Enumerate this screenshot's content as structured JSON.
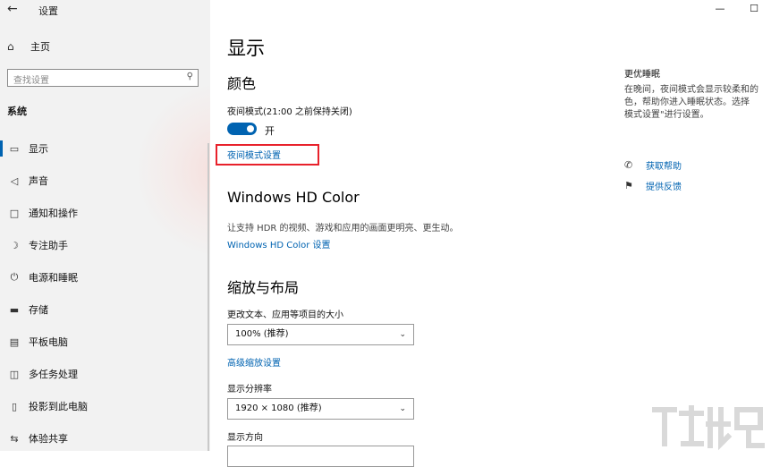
{
  "app": {
    "title": "设置",
    "back_icon": "back-arrow-icon",
    "window_controls": [
      "minimize",
      "maximize"
    ]
  },
  "sidebar": {
    "home_label": "主页",
    "search_placeholder": "查找设置",
    "section_title": "系统",
    "items": [
      {
        "label": "显示",
        "icon": "monitor-icon",
        "active": true
      },
      {
        "label": "声音",
        "icon": "speaker-icon"
      },
      {
        "label": "通知和操作",
        "icon": "notification-icon"
      },
      {
        "label": "专注助手",
        "icon": "moon-icon"
      },
      {
        "label": "电源和睡眠",
        "icon": "power-icon"
      },
      {
        "label": "存储",
        "icon": "storage-icon"
      },
      {
        "label": "平板电脑",
        "icon": "tablet-icon"
      },
      {
        "label": "多任务处理",
        "icon": "multitask-icon"
      },
      {
        "label": "投影到此电脑",
        "icon": "project-icon"
      },
      {
        "label": "体验共享",
        "icon": "share-icon"
      }
    ]
  },
  "main": {
    "page_title": "显示",
    "color": {
      "heading": "颜色",
      "night_light_label": "夜间模式(21:00 之前保持关闭)",
      "toggle_state": "开",
      "settings_link": "夜间模式设置"
    },
    "hdr": {
      "heading": "Windows HD Color",
      "description": "让支持 HDR 的视频、游戏和应用的画面更明亮、更生动。",
      "settings_link": "Windows HD Color 设置"
    },
    "scale": {
      "heading": "缩放与布局",
      "text_size_label": "更改文本、应用等项目的大小",
      "text_size_value": "100% (推荐)",
      "advanced_link": "高级缩放设置",
      "resolution_label": "显示分辨率",
      "resolution_value": "1920 × 1080 (推荐)",
      "orientation_label": "显示方向"
    }
  },
  "right_panel": {
    "title": "更优睡眠",
    "description_lines": [
      "在晚间，夜间模式会显示较柔和的",
      "色，帮助你进入睡眠状态。选择",
      "模式设置\"进行设置。"
    ],
    "help_link": "获取帮助",
    "feedback_link": "提供反馈"
  },
  "colors": {
    "accent": "#0063b1",
    "highlight": "#e8212b",
    "sidebar_bg": "#f2f2f2"
  }
}
